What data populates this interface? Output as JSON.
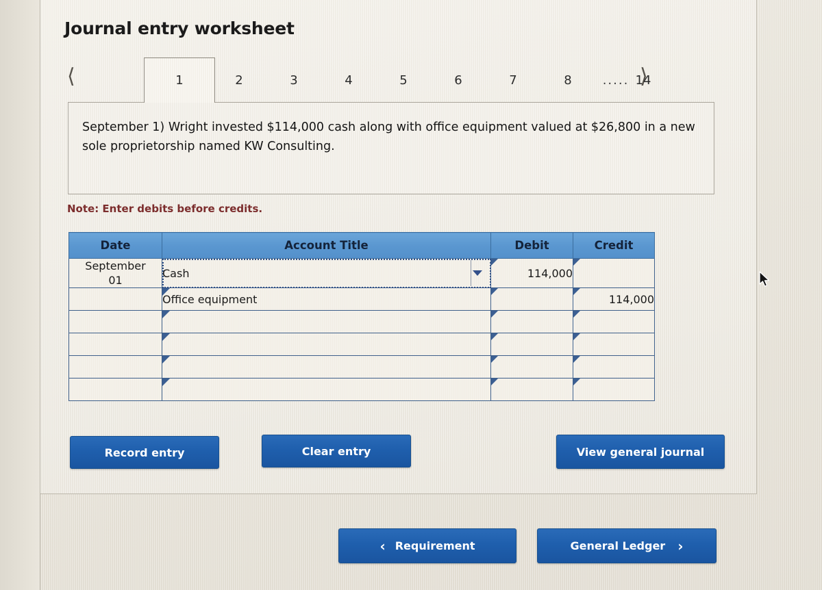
{
  "page": {
    "title": "Journal entry worksheet",
    "note": "Note: Enter debits before credits."
  },
  "tabs": {
    "prev_icon": "chevron-left-icon",
    "next_icon": "chevron-right-icon",
    "items": [
      "1",
      "2",
      "3",
      "4",
      "5",
      "6",
      "7",
      "8"
    ],
    "ellipsis": ".....",
    "last": "14",
    "active_index": 0
  },
  "transaction": {
    "text": "September 1) Wright invested $114,000 cash along with office equipment valued at $26,800 in a new sole proprietorship named KW Consulting."
  },
  "table": {
    "headers": [
      "Date",
      "Account Title",
      "Debit",
      "Credit"
    ],
    "rows": [
      {
        "date": "September\n01",
        "account": "Cash",
        "debit": "114,000",
        "credit": "",
        "selected": true,
        "dropdown": true,
        "indent": false
      },
      {
        "date": "",
        "account": "Office equipment",
        "debit": "",
        "credit": "114,000",
        "selected": false,
        "dropdown": false,
        "indent": true
      },
      {
        "date": "",
        "account": "",
        "debit": "",
        "credit": "",
        "selected": false,
        "dropdown": false,
        "indent": false
      },
      {
        "date": "",
        "account": "",
        "debit": "",
        "credit": "",
        "selected": false,
        "dropdown": false,
        "indent": false
      },
      {
        "date": "",
        "account": "",
        "debit": "",
        "credit": "",
        "selected": false,
        "dropdown": false,
        "indent": false
      },
      {
        "date": "",
        "account": "",
        "debit": "",
        "credit": "",
        "selected": false,
        "dropdown": false,
        "indent": false
      }
    ]
  },
  "buttons": {
    "record_entry": "Record entry",
    "clear_entry": "Clear entry",
    "view_general_journal": "View general journal",
    "requirement": "Requirement",
    "requirement_chevron": "‹",
    "general_ledger": "General Ledger",
    "general_ledger_chevron": "›"
  },
  "colors": {
    "header_blue": "#5a97d0",
    "button_blue": "#1f5fad",
    "note_red": "#7c2d2d",
    "grid_blue": "#3e5f8a",
    "page_bg": "#e9e5dc"
  }
}
